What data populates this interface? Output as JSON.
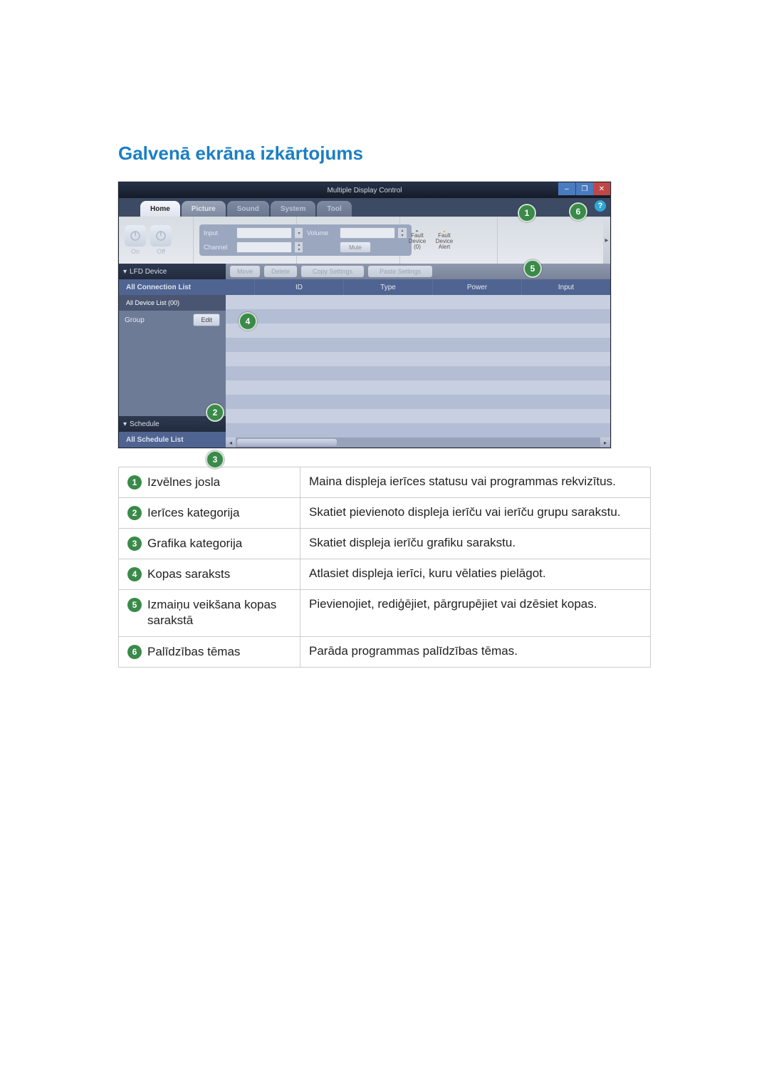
{
  "page_title": "Galvenā ekrāna izkārtojums",
  "app": {
    "title": "Multiple Display Control",
    "win": {
      "min": "–",
      "restore": "❐",
      "close": "✕"
    },
    "menu": {
      "home": "Home",
      "picture": "Picture",
      "sound": "Sound",
      "system": "System",
      "tool": "Tool"
    },
    "help_glyph": "?",
    "power": {
      "on": "On",
      "off": "Off"
    },
    "input_group": {
      "input": "Input",
      "channel": "Channel"
    },
    "volume_group": {
      "volume": "Volume",
      "mute": "Mute"
    },
    "fault": {
      "device": "Fault Device (0)",
      "alert": "Fault Device Alert"
    },
    "expand": "▸",
    "side": {
      "lfd": "LFD Device",
      "lfd_caret": "▾",
      "all_connection": "All Connection List",
      "all_device": "All Device List (00)",
      "group": "Group",
      "edit": "Edit",
      "schedule": "Schedule",
      "schedule_caret": "▾",
      "all_schedule": "All Schedule List"
    },
    "toolbar": {
      "move": "Move",
      "delete": "Delete",
      "copy": "Copy Settings",
      "paste": "Paste Settings"
    },
    "columns": {
      "blank": "",
      "id": "ID",
      "type": "Type",
      "power": "Power",
      "input": "Input"
    },
    "scroll": {
      "left": "◂",
      "right": "▸"
    }
  },
  "callouts": {
    "c1": "1",
    "c2": "2",
    "c3": "3",
    "c4": "4",
    "c5": "5",
    "c6": "6"
  },
  "legend": {
    "r1": {
      "num": "1",
      "label": "Izvēlnes josla",
      "desc": "Maina displeja ierīces statusu vai programmas rekvizītus."
    },
    "r2": {
      "num": "2",
      "label": "Ierīces kategorija",
      "desc": "Skatiet pievienoto displeja ierīču vai ierīču grupu sarakstu."
    },
    "r3": {
      "num": "3",
      "label": "Grafika kategorija",
      "desc": "Skatiet displeja ierīču grafiku sarakstu."
    },
    "r4": {
      "num": "4",
      "label": "Kopas saraksts",
      "desc": "Atlasiet displeja ierīci, kuru vēlaties pielāgot."
    },
    "r5": {
      "num": "5",
      "label": "Izmaiņu veikšana kopas sarakstā",
      "desc": "Pievienojiet, rediģējiet, pārgrupējiet vai dzēsiet kopas."
    },
    "r6": {
      "num": "6",
      "label": "Palīdzības tēmas",
      "desc": "Parāda programmas palīdzības tēmas."
    }
  }
}
